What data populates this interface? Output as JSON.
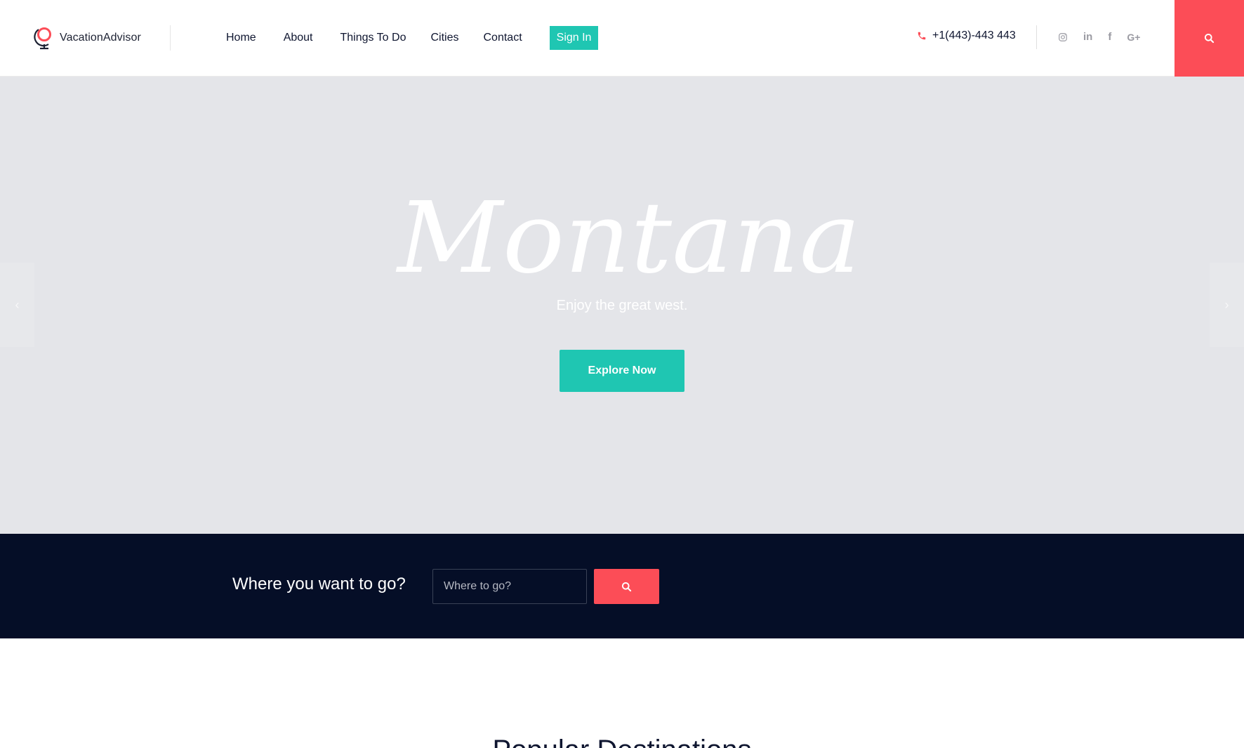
{
  "header": {
    "logo_text": "VacationAdvisor",
    "nav": {
      "home": "Home",
      "about": "About",
      "things": "Things To Do",
      "cities": "Cities",
      "contact": "Contact",
      "signin": "Sign In"
    },
    "phone": "+1(443)-443 443",
    "social_icons": [
      "instagram-icon",
      "linkedin-icon",
      "facebook-icon",
      "google-plus-icon"
    ],
    "social_glyphs": {
      "linkedin": "in",
      "facebook": "f",
      "googleplus": "G+"
    }
  },
  "hero": {
    "title": "Montana",
    "subtitle": "Enjoy the great west.",
    "button": "Explore Now",
    "prev_glyph": "‹",
    "next_glyph": "›"
  },
  "search": {
    "title": "Where you want to go?",
    "placeholder": "Where to go?"
  },
  "popular": {
    "title": "Popular Destinations"
  },
  "colors": {
    "accent_teal": "#1fc6b2",
    "accent_red": "#fc4d57",
    "dark_navy": "#050e27",
    "hero_bg": "#e4e5e9"
  }
}
